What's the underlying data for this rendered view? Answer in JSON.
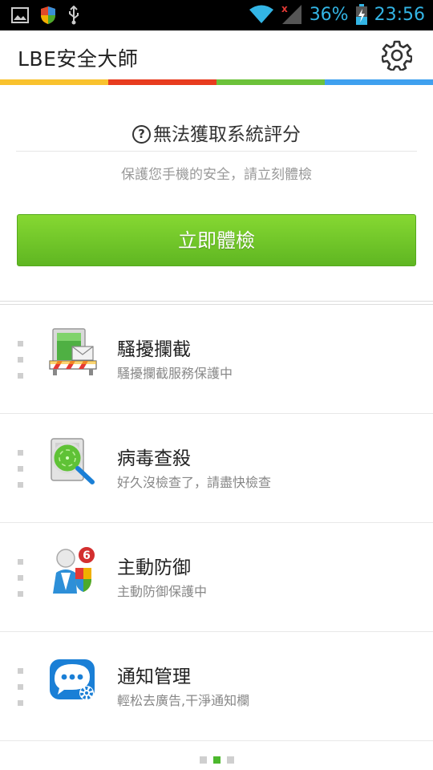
{
  "status_bar": {
    "battery": "36%",
    "time": "23:56",
    "icons": [
      "image-icon",
      "shield-icon",
      "usb-icon",
      "wifi-icon",
      "signal-icon",
      "battery-icon"
    ]
  },
  "app": {
    "title": "LBE安全大師",
    "settings_icon": "gear-icon",
    "accent_colors": [
      "#f9c22e",
      "#e83c1f",
      "#6cc23a",
      "#3fa0ef"
    ]
  },
  "score": {
    "title": "無法獲取系統評分",
    "subtitle": "保護您手機的安全，請立刻體檢",
    "button_label": "立即體檢"
  },
  "features": [
    {
      "title": "騷擾攔截",
      "subtitle": "騷擾攔截服務保護中",
      "icon": "harassment-block-icon"
    },
    {
      "title": "病毒查殺",
      "subtitle": "好久沒檢查了，請盡快檢查",
      "icon": "virus-scan-icon"
    },
    {
      "title": "主動防御",
      "subtitle": "主動防御保護中",
      "icon": "active-defense-icon",
      "badge": "6"
    },
    {
      "title": "通知管理",
      "subtitle": "輕松去廣告,干淨通知欄",
      "icon": "notification-manager-icon"
    }
  ],
  "pager": {
    "total": 3,
    "active": 2
  }
}
